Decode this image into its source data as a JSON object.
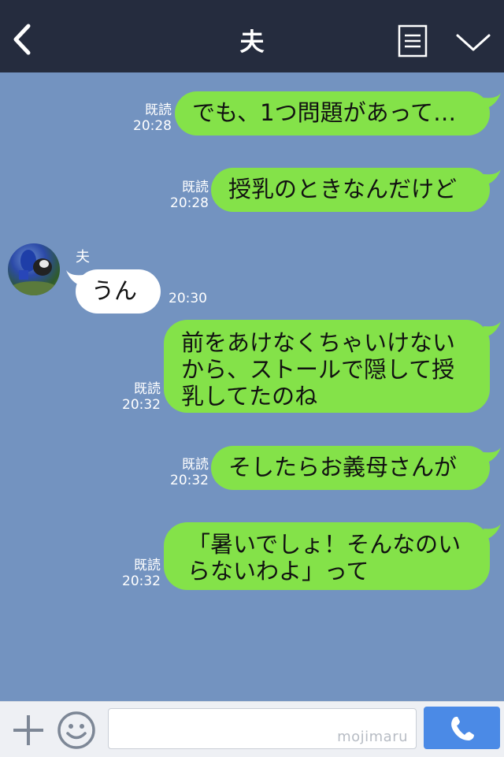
{
  "header": {
    "title": "夫",
    "back_icon": "chevron-left-icon",
    "menu_icon": "list-icon",
    "dropdown_icon": "chevron-down-icon",
    "bg_color": "#252c3e"
  },
  "chat": {
    "bg_color": "#7393c0",
    "sent_bubble_color": "#84e249",
    "received_bubble_color": "#ffffff",
    "messages": [
      {
        "direction": "out",
        "lines": [
          "でも、1つ問題があって…"
        ],
        "read_label": "既読",
        "time": "20:28"
      },
      {
        "direction": "out",
        "lines": [
          "授乳のときなんだけど"
        ],
        "read_label": "既読",
        "time": "20:28"
      },
      {
        "direction": "in",
        "sender": "夫",
        "lines": [
          "うん"
        ],
        "time": "20:30"
      },
      {
        "direction": "out",
        "lines": [
          "前をあけなくちゃいけない",
          "から、ストールで隠して授",
          "乳してたのね"
        ],
        "read_label": "既読",
        "time": "20:32"
      },
      {
        "direction": "out",
        "lines": [
          "そしたらお義母さんが"
        ],
        "read_label": "既読",
        "time": "20:32"
      },
      {
        "direction": "out",
        "lines": [
          "「暑いでしょ！そんなのい",
          "らないわよ」って"
        ],
        "read_label": "既読",
        "time": "20:32"
      }
    ]
  },
  "footer": {
    "add_icon": "plus-icon",
    "emoji_icon": "smiley-icon",
    "input_value": "",
    "watermark": "mojimaru",
    "call_icon": "phone-icon",
    "call_color": "#4b8ae6"
  }
}
